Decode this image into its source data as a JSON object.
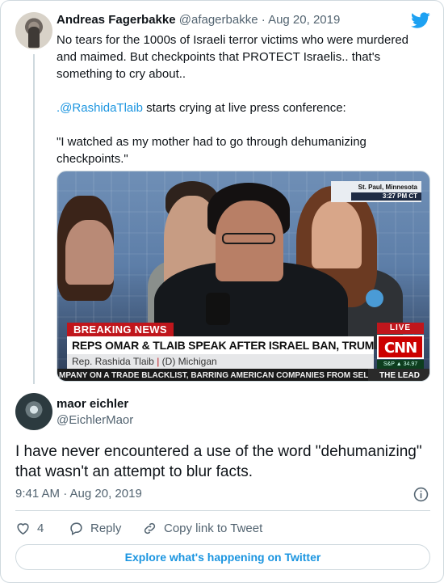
{
  "colors": {
    "link": "#1b95e0",
    "twitter_blue": "#1da1f2",
    "cnn_red": "#cc0000"
  },
  "parent_tweet": {
    "author_name": "Andreas Fagerbakke",
    "author_handle": "@afagerbakke",
    "separator": " · ",
    "date": "Aug 20, 2019",
    "text_line1": "No tears for the 1000s of Israeli terror victims who were murdered and maimed. But checkpoints that PROTECT Israelis.. that's something to cry about..",
    "text_prefix": ".",
    "mention": "@RashidaTlaib",
    "text_line2_rest": " starts crying at live press conference:",
    "text_line3": "\"I watched as my mother had to go through dehumanizing checkpoints.\"",
    "media": {
      "location": "St. Paul, Minnesota",
      "time": "3:27 PM CT",
      "breaking": "BREAKING NEWS",
      "headline": "REPS OMAR & TLAIB SPEAK AFTER ISRAEL BAN, TRUMP INSULTS",
      "speaker": "Rep. Rashida Tlaib",
      "speaker_sep": "|",
      "party": "(D) Michigan",
      "ticker": "MPANY ON A TRADE BLACKLIST, BARRING AMERICAN COMPANIES FROM SEL",
      "show": "THE LEAD",
      "live": "LIVE",
      "network": "CNN",
      "stock": "S&P ▲ 34.97"
    }
  },
  "reply_tweet": {
    "author_name": "maor eichler",
    "author_handle": "@EichlerMaor",
    "text": "I have never encountered a use of the word \"dehumanizing\" that wasn't an attempt to blur facts.",
    "timestamp": "9:41 AM · Aug 20, 2019",
    "like_count": "4",
    "reply_label": "Reply",
    "copy_link_label": "Copy link to Tweet"
  },
  "footer": {
    "explore_label": "Explore what's happening on Twitter"
  },
  "icons": [
    "twitter-bird-icon",
    "info-icon",
    "heart-icon",
    "reply-bubble-icon",
    "link-icon"
  ]
}
